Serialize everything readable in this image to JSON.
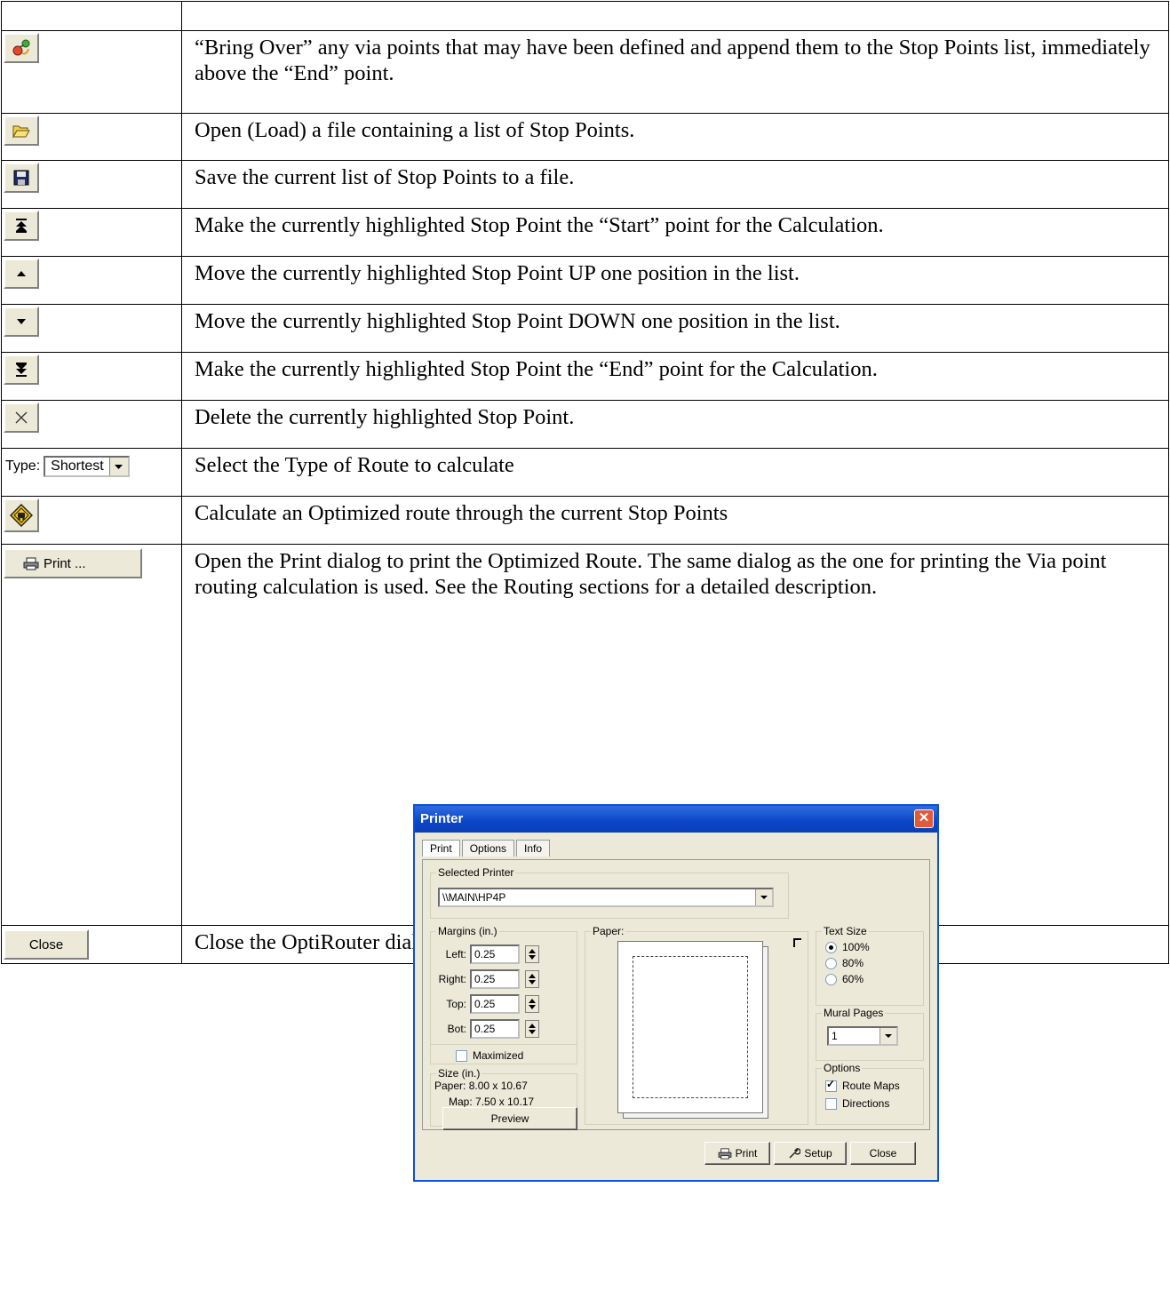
{
  "rows": [
    {
      "icon": "bring-over-icon",
      "text": "“Bring Over” any via points that may have been defined and append them to the Stop Points list, immediately above the “End” point."
    },
    {
      "icon": "open-folder-icon",
      "text": "Open (Load) a file containing a list of Stop Points."
    },
    {
      "icon": "save-disk-icon",
      "text": "Save the current list of Stop Points to a file."
    },
    {
      "icon": "move-to-top-icon",
      "text": "Make the currently highlighted Stop Point the “Start” point for the Calculation."
    },
    {
      "icon": "move-up-icon",
      "text": "Move the currently highlighted Stop Point UP one position in the list."
    },
    {
      "icon": "move-down-icon",
      "text": "Move the currently highlighted Stop Point DOWN one position in the list."
    },
    {
      "icon": "move-to-bottom-icon",
      "text": "Make the currently highlighted Stop Point the “End” point for the Calculation."
    },
    {
      "icon": "delete-x-icon",
      "text": "Delete the currently highlighted Stop Point."
    },
    {
      "type_label": "Type:",
      "type_value": "Shortest",
      "text": "Select the Type of Route to calculate"
    },
    {
      "icon": "calculate-route-icon",
      "text": "Calculate an Optimized route through the current Stop Points"
    },
    {
      "button_label": "Print ...",
      "text": "Open the Print dialog to print the Optimized Route. The same dialog as the one for printing the Via point routing calculation is used.  See the Routing sections for a detailed description."
    },
    {
      "button_label": "Close",
      "text": "Close the OptiRouter dialog."
    }
  ],
  "printer_dialog": {
    "title": "Printer",
    "tabs": [
      "Print",
      "Options",
      "Info"
    ],
    "selected_printer_label": "Selected Printer",
    "selected_printer_value": "\\\\MAIN\\HP4P",
    "margins_label": "Margins (in.)",
    "margins": [
      {
        "label": "Left:",
        "value": "0.25"
      },
      {
        "label": "Right:",
        "value": "0.25"
      },
      {
        "label": "Top:",
        "value": "0.25"
      },
      {
        "label": "Bot:",
        "value": "0.25"
      }
    ],
    "maximized_label": "Maximized",
    "size_label": "Size (in.)",
    "paper_size_label": "Paper:",
    "paper_size_value": "8.00 x 10.67",
    "map_size_label": "Map:",
    "map_size_value": "7.50 x 10.17",
    "preview_label": "Preview",
    "paper_group_label": "Paper:",
    "text_size_label": "Text Size",
    "text_sizes": [
      "100%",
      "80%",
      "60%"
    ],
    "text_size_selected": "100%",
    "mural_pages_label": "Mural Pages",
    "mural_pages_value": "1",
    "options_label": "Options",
    "route_maps_label": "Route Maps",
    "route_maps_checked": true,
    "directions_label": "Directions",
    "directions_checked": false,
    "print_label": "Print",
    "setup_label": "Setup",
    "close_label": "Close"
  }
}
